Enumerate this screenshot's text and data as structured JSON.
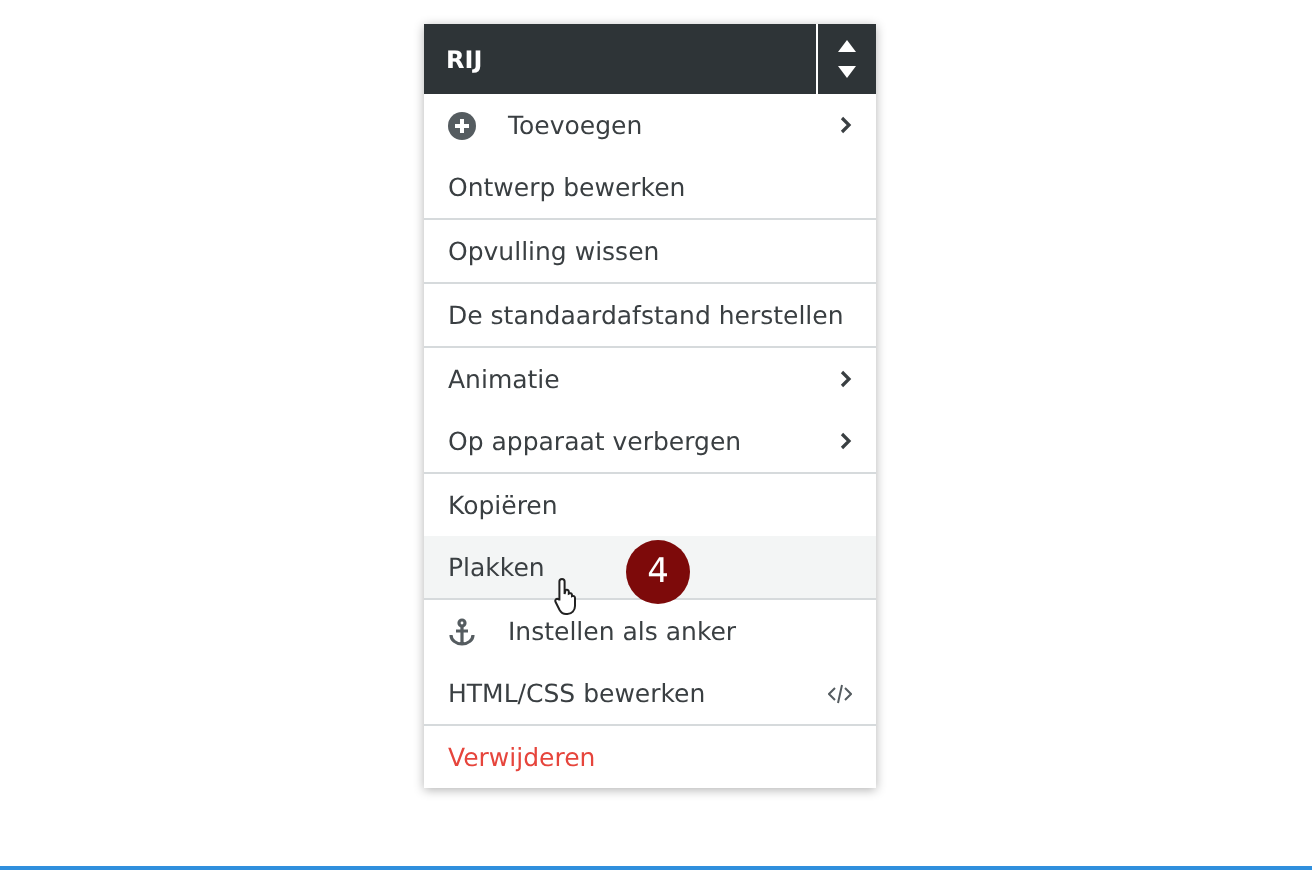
{
  "menu": {
    "title": "RIJ",
    "groups": [
      {
        "items": [
          {
            "label": "Toevoegen",
            "kind": "add",
            "submenu": true,
            "hovered": false
          },
          {
            "label": "Ontwerp bewerken",
            "kind": "plain",
            "submenu": false,
            "hovered": false
          }
        ]
      },
      {
        "items": [
          {
            "label": "Opvulling wissen",
            "kind": "plain",
            "submenu": false,
            "hovered": false
          }
        ]
      },
      {
        "items": [
          {
            "label": "De standaardafstand herstellen",
            "kind": "plain",
            "submenu": false,
            "hovered": false
          }
        ]
      },
      {
        "items": [
          {
            "label": "Animatie",
            "kind": "plain",
            "submenu": true,
            "hovered": false
          },
          {
            "label": "Op apparaat verbergen",
            "kind": "plain",
            "submenu": true,
            "hovered": false
          }
        ]
      },
      {
        "items": [
          {
            "label": "Kopiëren",
            "kind": "plain",
            "submenu": false,
            "hovered": false
          },
          {
            "label": "Plakken",
            "kind": "plain",
            "submenu": false,
            "hovered": true
          }
        ]
      },
      {
        "items": [
          {
            "label": "Instellen als anker",
            "kind": "anchor",
            "submenu": false,
            "hovered": false
          },
          {
            "label": "HTML/CSS bewerken",
            "kind": "code",
            "submenu": false,
            "hovered": false
          }
        ]
      },
      {
        "items": [
          {
            "label": "Verwijderen",
            "kind": "danger",
            "submenu": false,
            "hovered": false
          }
        ]
      }
    ]
  },
  "step_badge": "4"
}
